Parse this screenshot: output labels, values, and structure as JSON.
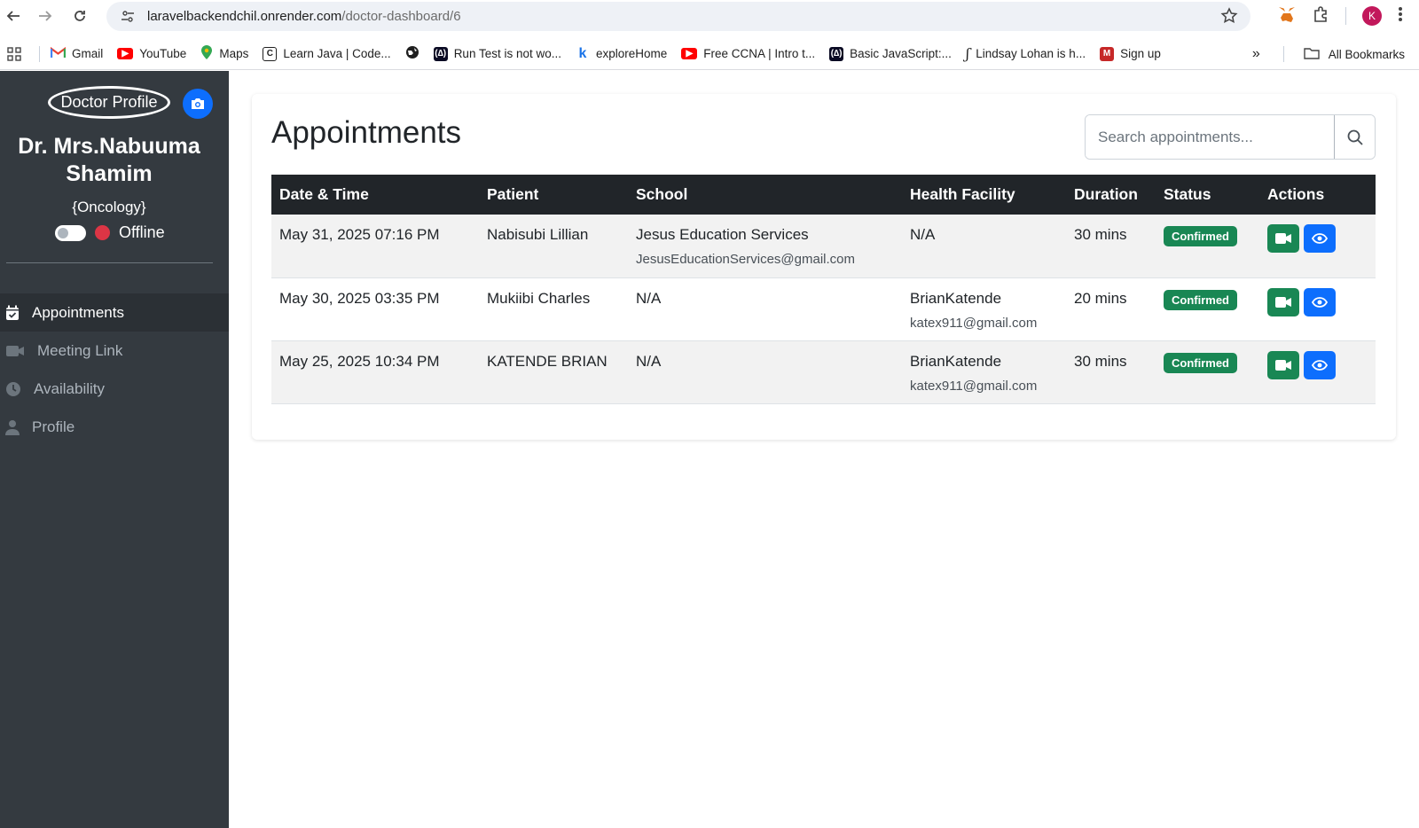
{
  "browser": {
    "url_host": "laravelbackendchil.onrender.com",
    "url_path": "/doctor-dashboard/6",
    "profile_initial": "K",
    "bookmarks": [
      {
        "label": "Gmail",
        "icon": "gmail-icon",
        "color": "#ea4335"
      },
      {
        "label": "YouTube",
        "icon": "youtube-icon",
        "color": "#ff0000"
      },
      {
        "label": "Maps",
        "icon": "maps-icon",
        "color": "#34a853"
      },
      {
        "label": "Learn Java | Code...",
        "icon": "codecademy-icon",
        "color": "#1f1f1f"
      },
      {
        "label": "",
        "icon": "globe-icon",
        "color": "#1f1f1f"
      },
      {
        "label": "Run Test is not wo...",
        "icon": "freecodecamp-icon",
        "color": "#0a0a23"
      },
      {
        "label": "exploreHome",
        "icon": "k-icon",
        "color": "#1a73e8"
      },
      {
        "label": "Free CCNA | Intro t...",
        "icon": "youtube-icon",
        "color": "#ff0000"
      },
      {
        "label": "Basic JavaScript:...",
        "icon": "freecodecamp-icon",
        "color": "#0a0a23"
      },
      {
        "label": "Lindsay Lohan is h...",
        "icon": "medium-icon",
        "color": "#1f1f1f"
      },
      {
        "label": "Sign up",
        "icon": "m-icon",
        "color": "#c62828"
      }
    ],
    "all_bookmarks": "All Bookmarks"
  },
  "sidebar": {
    "profile_image_alt": "Doctor Profile",
    "doctor_name": "Dr. Mrs.Nabuuma Shamim",
    "specialty": "{Oncology}",
    "status": "Offline",
    "menu": [
      {
        "label": "Appointments",
        "icon": "calendar-check-icon",
        "active": true
      },
      {
        "label": "Meeting Link",
        "icon": "video-icon",
        "active": false
      },
      {
        "label": "Availability",
        "icon": "clock-icon",
        "active": false
      },
      {
        "label": "Profile",
        "icon": "user-icon",
        "active": false
      }
    ]
  },
  "main": {
    "title": "Appointments",
    "search_placeholder": "Search appointments...",
    "columns": [
      "Date & Time",
      "Patient",
      "School",
      "Health Facility",
      "Duration",
      "Status",
      "Actions"
    ],
    "rows": [
      {
        "datetime": "May 31, 2025 07:16 PM",
        "patient": "Nabisubi Lillian",
        "school": "Jesus Education Services",
        "school_email": "JesusEducationServices@gmail.com",
        "facility": "N/A",
        "facility_email": "",
        "duration": "30 mins",
        "status": "Confirmed"
      },
      {
        "datetime": "May 30, 2025 03:35 PM",
        "patient": "Mukiibi Charles",
        "school": "N/A",
        "school_email": "",
        "facility": "BrianKatende",
        "facility_email": "katex911@gmail.com",
        "duration": "20 mins",
        "status": "Confirmed"
      },
      {
        "datetime": "May 25, 2025 10:34 PM",
        "patient": "KATENDE BRIAN",
        "school": "N/A",
        "school_email": "",
        "facility": "BrianKatende",
        "facility_email": "katex911@gmail.com",
        "duration": "30 mins",
        "status": "Confirmed"
      }
    ]
  },
  "colors": {
    "sidebar_bg": "#343a40",
    "primary": "#0d6efd",
    "success": "#198754",
    "table_header": "#212529",
    "offline_dot": "#dc3545"
  }
}
